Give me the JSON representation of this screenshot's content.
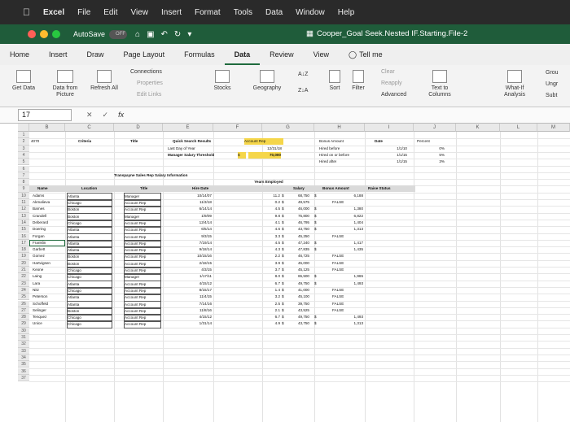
{
  "menubar": {
    "app": "Excel",
    "items": [
      "File",
      "Edit",
      "View",
      "Insert",
      "Format",
      "Tools",
      "Data",
      "Window",
      "Help"
    ]
  },
  "titlebar": {
    "autosave": "AutoSave",
    "toggle": "OFF",
    "doc_title": "Cooper_Goal Seek.Nested IF.Starting.File-2"
  },
  "tabs": [
    "Home",
    "Insert",
    "Draw",
    "Page Layout",
    "Formulas",
    "Data",
    "Review",
    "View"
  ],
  "active_tab": "Data",
  "tell_me": "Tell me",
  "ribbon": {
    "get_data": "Get Data",
    "data_from_picture": "Data from Picture",
    "refresh_all": "Refresh All",
    "connections": "Connections",
    "properties": "Properties",
    "edit_links": "Edit Links",
    "stocks": "Stocks",
    "geography": "Geography",
    "sort": "Sort",
    "filter": "Filter",
    "clear": "Clear",
    "reapply": "Reapply",
    "advanced": "Advanced",
    "text_to_columns": "Text to Columns",
    "what_if": "What-If Analysis",
    "group": "Grou",
    "ungroup": "Ungr",
    "subtotal": "Subt"
  },
  "formula_bar": {
    "cell_ref": "17",
    "fx": "fx",
    "content": ""
  },
  "columns": [
    "B",
    "C",
    "D",
    "E",
    "F",
    "G",
    "H",
    "I",
    "J",
    "K",
    "L",
    "M",
    "N",
    "O"
  ],
  "rows": [
    "1",
    "2",
    "3",
    "4",
    "5",
    "6",
    "7",
    "8",
    "9",
    "10",
    "11",
    "12",
    "13",
    "14",
    "15",
    "16",
    "17",
    "18",
    "19",
    "20",
    "21",
    "22",
    "23",
    "24",
    "25",
    "26",
    "27",
    "28",
    "29",
    "30",
    "31",
    "32",
    "33",
    "34",
    "35",
    "36",
    "37"
  ],
  "top_cells": {
    "b2": "4070",
    "c2": "Criteria",
    "d2": "Title",
    "quick_search": "Quick Search Results",
    "account_rep": "Account Rep",
    "last_day": "Last Day of Year",
    "last_day_val": "12/31/18",
    "threshold": "Manager Salary Threshold",
    "threshold_cur": "$",
    "threshold_val": "70,000",
    "bonus_amount": "Bonus Amount",
    "date_hdr": "Date",
    "percent_hdr": "Percent",
    "hired_before": "Hired before",
    "hired_on_before": "Hired on or before",
    "hired_after": "Hired after",
    "date1": "1/1/10",
    "date2": "1/1/15",
    "date3": "1/1/15",
    "pct1": "0%",
    "pct2": "5%",
    "pct3": "3%"
  },
  "table_title": "Transpayne Sales Rep Salary Information",
  "table_headers": {
    "name": "Name",
    "location": "Location",
    "title": "Title",
    "hire_date": "Hire Date",
    "years": "Years Employed",
    "salary": "Salary",
    "bonus": "Bonus Amount",
    "raise": "Raise Status"
  },
  "employees": [
    {
      "name": "Adams",
      "loc": "Atlanta",
      "title": "Manager",
      "hire": "10/14/07",
      "yrs": "11.2",
      "sal": "68,750",
      "bonus": "6,188"
    },
    {
      "name": "Akmalieva",
      "loc": "Chicago",
      "title": "Account Rep",
      "hire": "11/3/18",
      "yrs": "0.2",
      "sal": "49,575",
      "bonus": "FALSE"
    },
    {
      "name": "Barnes",
      "loc": "Boston",
      "title": "Account Rep",
      "hire": "6/14/14",
      "yrs": "4.5",
      "sal": "46,000",
      "bonus": "1,380"
    },
    {
      "name": "Crandell",
      "loc": "Boston",
      "title": "Manager",
      "hire": "1/9/09",
      "yrs": "9.8",
      "sal": "75,800",
      "bonus": "6,822"
    },
    {
      "name": "Deberard",
      "loc": "Chicago",
      "title": "Account Rep",
      "hire": "12/4/14",
      "yrs": "4.1",
      "sal": "46,795",
      "bonus": "1,404"
    },
    {
      "name": "Doering",
      "loc": "Atlanta",
      "title": "Account Rep",
      "hire": "6/5/14",
      "yrs": "4.6",
      "sal": "43,750",
      "bonus": "1,313"
    },
    {
      "name": "Forgan",
      "loc": "Atlanta",
      "title": "Account Rep",
      "hire": "9/3/15",
      "yrs": "3.3",
      "sal": "45,250",
      "bonus": "FALSE"
    },
    {
      "name": "Franklin",
      "loc": "Atlanta",
      "title": "Account Rep",
      "hire": "7/19/14",
      "yrs": "4.5",
      "sal": "47,240",
      "bonus": "1,417"
    },
    {
      "name": "Garbett",
      "loc": "Atlanta",
      "title": "Account Rep",
      "hire": "9/18/14",
      "yrs": "4.3",
      "sal": "47,835",
      "bonus": "1,435"
    },
    {
      "name": "Gomez",
      "loc": "Boston",
      "title": "Account Rep",
      "hire": "10/15/16",
      "yrs": "2.2",
      "sal": "46,725",
      "bonus": "FALSE"
    },
    {
      "name": "Hartvigsen",
      "loc": "Boston",
      "title": "Account Rep",
      "hire": "2/18/15",
      "yrs": "3.9",
      "sal": "45,000",
      "bonus": "FALSE"
    },
    {
      "name": "Keone",
      "loc": "Chicago",
      "title": "Account Rep",
      "hire": "4/3/15",
      "yrs": "3.7",
      "sal": "45,125",
      "bonus": "FALSE"
    },
    {
      "name": "Laing",
      "loc": "Chicago",
      "title": "Manager",
      "hire": "1/17/11",
      "yrs": "8.0",
      "sal": "65,500",
      "bonus": "1,965"
    },
    {
      "name": "Lara",
      "loc": "Atlanta",
      "title": "Account Rep",
      "hire": "4/15/12",
      "yrs": "6.7",
      "sal": "49,750",
      "bonus": "1,493"
    },
    {
      "name": "Nitz",
      "loc": "Chicago",
      "title": "Account Rep",
      "hire": "8/15/17",
      "yrs": "1.4",
      "sal": "41,000",
      "bonus": "FALSE"
    },
    {
      "name": "Peterson",
      "loc": "Atlanta",
      "title": "Account Rep",
      "hire": "11/4/15",
      "yrs": "3.2",
      "sal": "45,100",
      "bonus": "FALSE"
    },
    {
      "name": "Schoffeld",
      "loc": "Atlanta",
      "title": "Account Rep",
      "hire": "7/14/16",
      "yrs": "2.5",
      "sal": "39,750",
      "bonus": "FALSE"
    },
    {
      "name": "Selinger",
      "loc": "Boston",
      "title": "Account Rep",
      "hire": "11/8/16",
      "yrs": "2.1",
      "sal": "43,525",
      "bonus": "FALSE"
    },
    {
      "name": "Tenquez",
      "loc": "Chicago",
      "title": "Account Rep",
      "hire": "4/15/12",
      "yrs": "6.7",
      "sal": "49,750",
      "bonus": "1,493"
    },
    {
      "name": "Unice",
      "loc": "Chicago",
      "title": "Account Rep",
      "hire": "1/31/14",
      "yrs": "4.9",
      "sal": "43,750",
      "bonus": "1,313"
    }
  ],
  "colors": {
    "title_green": "#1f5c3a",
    "selected_yellow": "#f5d64a"
  }
}
